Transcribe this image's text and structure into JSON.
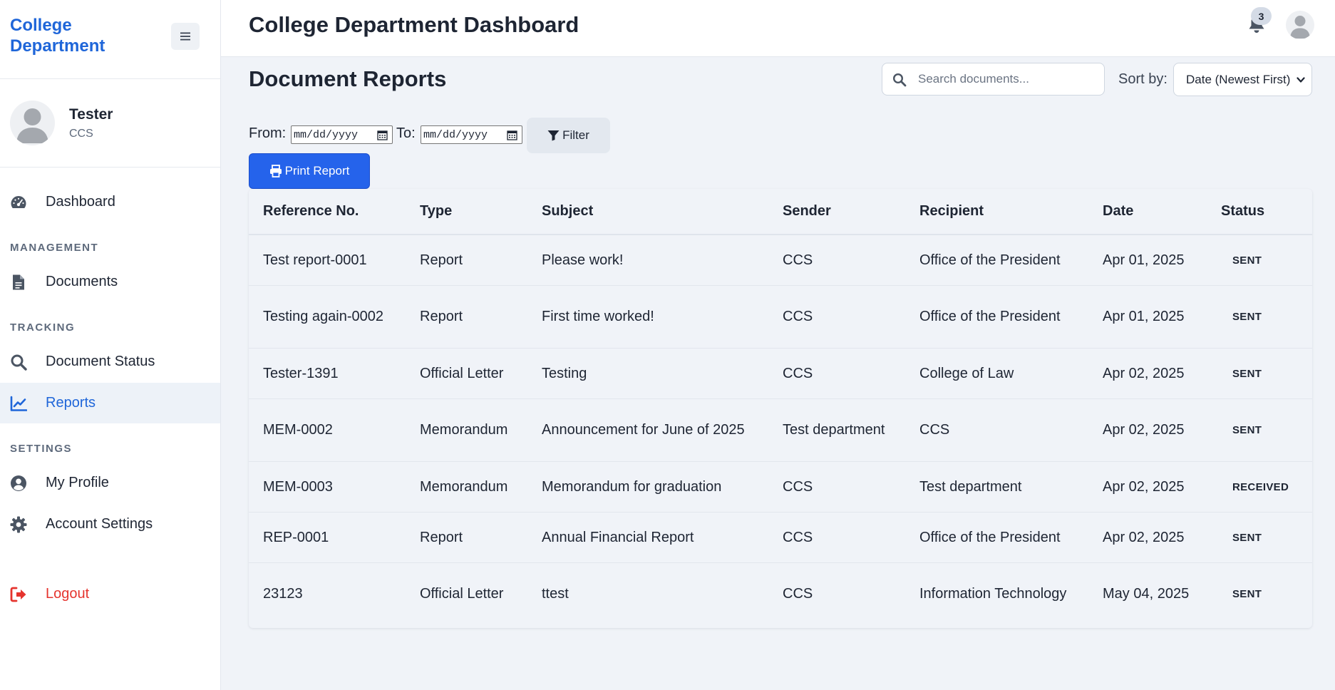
{
  "sidebar": {
    "brand": "College Department",
    "user": {
      "name": "Tester",
      "department": "CCS"
    },
    "nav": {
      "dashboard": "Dashboard",
      "management_section": "MANAGEMENT",
      "documents": "Documents",
      "tracking_section": "TRACKING",
      "document_status": "Document Status",
      "reports": "Reports",
      "settings_section": "SETTINGS",
      "my_profile": "My Profile",
      "account_settings": "Account Settings",
      "logout": "Logout"
    },
    "active_item": "Reports"
  },
  "header": {
    "title": "College Department Dashboard",
    "notification_count": "3"
  },
  "main": {
    "title": "Document Reports",
    "search_placeholder": "Search documents...",
    "sort_label": "Sort by:",
    "sort_value": "Date (Newest First)",
    "from_label": "From:",
    "to_label": "To:",
    "date_placeholder": "mm/dd/yyyy",
    "filter_label": "Filter",
    "print_label": "Print Report"
  },
  "table": {
    "columns": [
      "Reference No.",
      "Type",
      "Subject",
      "Sender",
      "Recipient",
      "Date",
      "Status"
    ],
    "rows": [
      [
        "Test report-0001",
        "Report",
        "Please work!",
        "CCS",
        "Office of the President",
        "Apr 01, 2025",
        "SENT"
      ],
      [
        "Testing again-0002",
        "Report",
        "First time worked!",
        "CCS",
        "Office of the President",
        "Apr 01, 2025",
        "SENT"
      ],
      [
        "Tester-1391",
        "Official Letter",
        "Testing",
        "CCS",
        "College of Law",
        "Apr 02, 2025",
        "SENT"
      ],
      [
        "MEM-0002",
        "Memorandum",
        "Announcement for June of 2025",
        "Test department",
        "CCS",
        "Apr 02, 2025",
        "SENT"
      ],
      [
        "MEM-0003",
        "Memorandum",
        "Memorandum for graduation",
        "CCS",
        "Test department",
        "Apr 02, 2025",
        "RECEIVED"
      ],
      [
        "REP-0001",
        "Report",
        "Annual Financial Report",
        "CCS",
        "Office of the President",
        "Apr 02, 2025",
        "SENT"
      ],
      [
        "23123",
        "Official Letter",
        "ttest",
        "CCS",
        "Information Technology",
        "May 04, 2025",
        "SENT"
      ]
    ]
  },
  "colors": {
    "accent": "#2563eb",
    "brand": "#1f66d9",
    "logout": "#e5342e",
    "background": "#f0f3f8"
  }
}
